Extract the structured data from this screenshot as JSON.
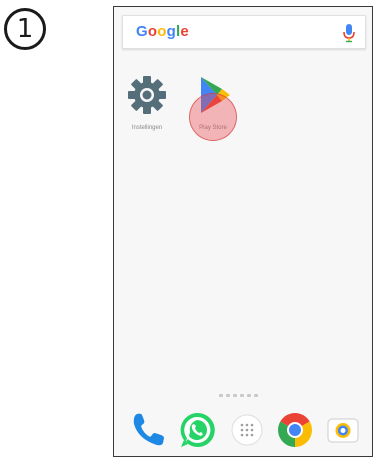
{
  "step": {
    "number": "1"
  },
  "search": {
    "logo_text": "Google",
    "logo_colors": [
      "#4285F4",
      "#EA4335",
      "#FBBC05",
      "#4285F4",
      "#34A853",
      "#EA4335"
    ]
  },
  "apps": [
    {
      "label": "Instellingen",
      "icon": "settings-gear-icon"
    },
    {
      "label": "Play Store",
      "icon": "play-store-icon"
    }
  ],
  "home_pages": {
    "count": 6
  },
  "dock": [
    {
      "name": "phone-icon"
    },
    {
      "name": "whatsapp-icon"
    },
    {
      "name": "app-drawer-icon"
    },
    {
      "name": "chrome-icon"
    },
    {
      "name": "camera-icon"
    }
  ],
  "colors": {
    "touch_indicator": "#EB464B",
    "phone_blue": "#1E88E5",
    "whatsapp_green": "#25D366"
  }
}
